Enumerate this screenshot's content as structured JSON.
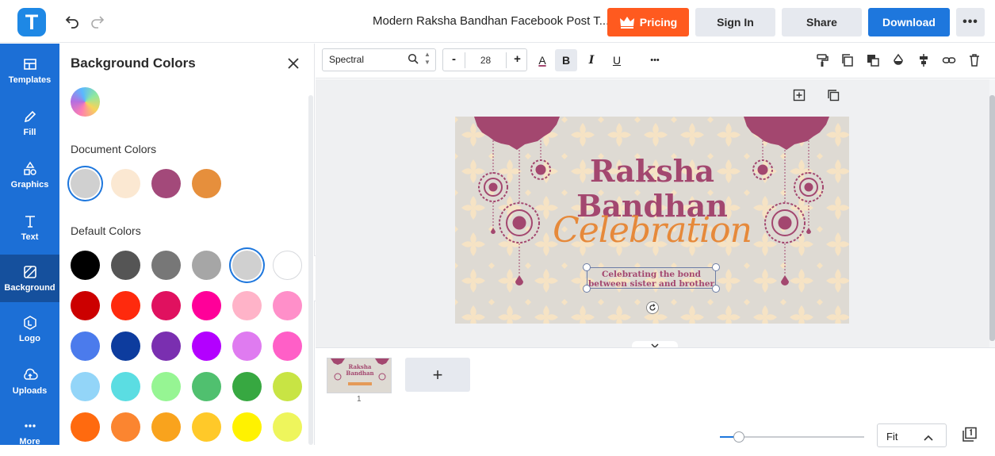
{
  "app": {
    "logo_letter": "T"
  },
  "header": {
    "doc_title": "Modern Raksha Bandhan Facebook Post T...",
    "pricing_label": "Pricing",
    "signin_label": "Sign In",
    "share_label": "Share",
    "download_label": "Download",
    "more_label": "•••"
  },
  "rail": {
    "items": [
      {
        "label": "Templates",
        "icon": "templates-icon"
      },
      {
        "label": "Fill",
        "icon": "pencil-icon"
      },
      {
        "label": "Graphics",
        "icon": "shapes-icon"
      },
      {
        "label": "Text",
        "icon": "text-icon"
      },
      {
        "label": "Background",
        "icon": "hatch-icon",
        "active": true
      },
      {
        "label": "Logo",
        "icon": "logo-icon"
      },
      {
        "label": "Uploads",
        "icon": "cloud-upload-icon"
      },
      {
        "label": "More",
        "icon": "more-dots-icon"
      }
    ]
  },
  "panel": {
    "title": "Background Colors",
    "document_colors_label": "Document Colors",
    "default_colors_label": "Default Colors",
    "document_colors": [
      "#d0d0d0",
      "#fbe8d2",
      "#a3497a",
      "#e68f3c"
    ],
    "default_colors": [
      [
        "#000000",
        "#555555",
        "#777777",
        "#a6a6a6",
        "#d0d0d0",
        "#ffffff"
      ],
      [
        "#cc0000",
        "#ff2a0d",
        "#e0115f",
        "#ff0099",
        "#ffb3c8",
        "#ff8fc9"
      ],
      [
        "#4b7bec",
        "#0d3c9e",
        "#7a2fb0",
        "#b300ff",
        "#df7bf0",
        "#ff5fc7"
      ],
      [
        "#93d5f8",
        "#5bdde2",
        "#96f593",
        "#50c06f",
        "#37a841",
        "#c8e444"
      ],
      [
        "#ff6a0f",
        "#fb8530",
        "#f9a31d",
        "#ffc929",
        "#fff200",
        "#eef55c"
      ]
    ],
    "selected_document_index": 0,
    "selected_default": [
      0,
      4
    ]
  },
  "toolbar": {
    "font_name": "Spectral",
    "font_size": "28",
    "minus": "-",
    "plus": "+",
    "bold": "B",
    "italic": "I",
    "underline": "U",
    "color_letter": "A",
    "more": "•••"
  },
  "design": {
    "title_line1": "Raksha",
    "title_line2": "Bandhan",
    "script_text": "Celebration",
    "tagline_line1": "Celebrating the bond",
    "tagline_line2": "between sister and brother",
    "background": "#dedad3",
    "accent_plum": "#a3476f",
    "accent_orange": "#e6893a",
    "pattern_color": "#f6e3c4"
  },
  "pages": {
    "page_number": "1",
    "add_label": "+",
    "thumb_line1": "Raksha",
    "thumb_line2": "Bandhan"
  },
  "zoom": {
    "value": "Fit"
  }
}
